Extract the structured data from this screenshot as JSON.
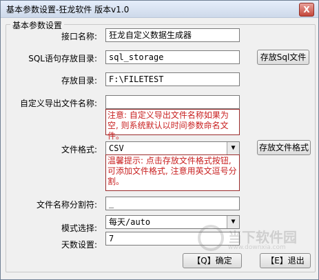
{
  "window": {
    "title": "基本参数设置-狂龙软件 版本v1.0",
    "close": "X"
  },
  "group": {
    "label": "基本参数设置"
  },
  "fields": {
    "interface_name": {
      "label": "接口名称:",
      "value": "狂龙自定义数据生成器"
    },
    "sql_dir": {
      "label": "SQL语句存放目录:",
      "value": "sql_storage",
      "button": "存放Sql文件"
    },
    "store_dir": {
      "label": "存放目录:",
      "value": "F:\\FILETEST"
    },
    "custom_export_name": {
      "label": "自定义导出文件名称:",
      "value": ""
    },
    "custom_note": "注意: 自定义导出文件名称如果为空, 则系统默认以时间参数命名文件。",
    "file_format": {
      "label": "文件格式:",
      "value": "CSV",
      "button": "存放文件格式"
    },
    "format_note": "温馨提示: 点击存放文件格式按钮, 可添加文件格式, 注意用英文逗号分割。",
    "name_separator": {
      "label": "文件名称分割符:",
      "value": "_"
    },
    "mode_select": {
      "label": "模式选择:",
      "value": "每天/auto"
    },
    "days_setting": {
      "label": "天数设置:",
      "value": "7"
    }
  },
  "buttons": {
    "ok": "【Q】确定",
    "exit": "【E】退出"
  },
  "watermark": {
    "text": "当下软件园",
    "url": "www.downxia.com"
  }
}
